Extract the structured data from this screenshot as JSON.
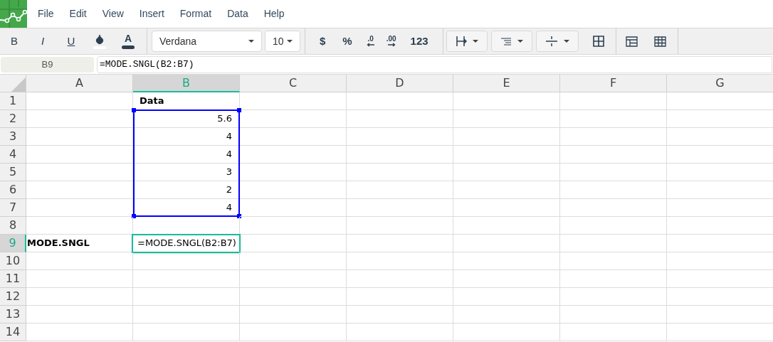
{
  "menu": [
    "File",
    "Edit",
    "View",
    "Insert",
    "Format",
    "Data",
    "Help"
  ],
  "toolbar": {
    "style_buttons": [
      {
        "kind": "bold",
        "label": "B"
      },
      {
        "kind": "italic",
        "label": "I"
      },
      {
        "kind": "underline",
        "label": "U"
      },
      {
        "kind": "fill"
      },
      {
        "kind": "text-color",
        "label": "A"
      }
    ],
    "font": "Verdana",
    "size": "10",
    "format_buttons": [
      {
        "kind": "text",
        "label": "$"
      },
      {
        "kind": "text",
        "label": "%"
      },
      {
        "kind": "decrease-decimal",
        "label": ".0"
      },
      {
        "kind": "increase-decimal",
        "label": ".00"
      },
      {
        "kind": "text",
        "label": "123"
      }
    ],
    "dropdowns": [
      {
        "kind": "borders"
      },
      {
        "kind": "align"
      },
      {
        "kind": "valign"
      }
    ],
    "tools": [
      {
        "kind": "merge"
      },
      {
        "kind": "freeze"
      },
      {
        "kind": "grid"
      }
    ]
  },
  "name_box": "B9",
  "formula": "=MODE.SNGL(B2:B7)",
  "columns": [
    {
      "label": "A",
      "selected": false
    },
    {
      "label": "B",
      "selected": true
    },
    {
      "label": "C",
      "selected": false
    },
    {
      "label": "D",
      "selected": false
    },
    {
      "label": "E",
      "selected": false
    },
    {
      "label": "F",
      "selected": false
    },
    {
      "label": "G",
      "selected": false
    }
  ],
  "rows": [
    {
      "label": "1",
      "selected": false,
      "cells": {
        "B": {
          "text": "Data",
          "kind": "text",
          "bold": true
        }
      }
    },
    {
      "label": "2",
      "selected": false,
      "cells": {
        "B": {
          "text": "5.6",
          "kind": "number",
          "bold": false,
          "highlighted": true
        }
      }
    },
    {
      "label": "3",
      "selected": false,
      "cells": {
        "B": {
          "text": "4",
          "kind": "number",
          "bold": false,
          "highlighted": true
        }
      }
    },
    {
      "label": "4",
      "selected": false,
      "cells": {
        "B": {
          "text": "4",
          "kind": "number",
          "bold": false,
          "highlighted": true
        }
      }
    },
    {
      "label": "5",
      "selected": false,
      "cells": {
        "B": {
          "text": "3",
          "kind": "number",
          "bold": false,
          "highlighted": true
        }
      }
    },
    {
      "label": "6",
      "selected": false,
      "cells": {
        "B": {
          "text": "2",
          "kind": "number",
          "bold": false,
          "highlighted": true
        }
      }
    },
    {
      "label": "7",
      "selected": false,
      "cells": {
        "B": {
          "text": "4",
          "kind": "number",
          "bold": false,
          "highlighted": true
        }
      }
    },
    {
      "label": "8",
      "selected": false,
      "cells": {}
    },
    {
      "label": "9",
      "selected": true,
      "cells": {
        "A": {
          "text": "MODE.SNGL",
          "kind": "text",
          "bold": true
        },
        "B": {
          "text": "=MODE.SNGL(B2:B7)",
          "kind": "text",
          "bold": false,
          "active": true
        }
      }
    },
    {
      "label": "10",
      "selected": false,
      "cells": {}
    },
    {
      "label": "11",
      "selected": false,
      "cells": {}
    },
    {
      "label": "12",
      "selected": false,
      "cells": {}
    },
    {
      "label": "13",
      "selected": false,
      "cells": {}
    },
    {
      "label": "14",
      "selected": false,
      "cells": {}
    }
  ]
}
